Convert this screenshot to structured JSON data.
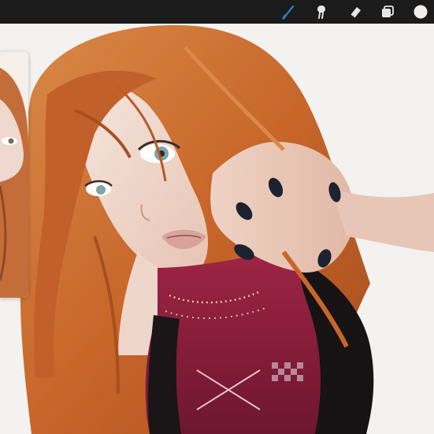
{
  "toolbar": {
    "tools": [
      {
        "name": "brush",
        "icon": "brush-icon",
        "active": true
      },
      {
        "name": "smudge",
        "icon": "smudge-icon",
        "active": false
      },
      {
        "name": "eraser",
        "icon": "eraser-icon",
        "active": false
      },
      {
        "name": "layers",
        "icon": "layers-icon",
        "active": false
      },
      {
        "name": "color",
        "icon": "color-swatch",
        "active": false
      }
    ],
    "active_color": "#3a7bd5",
    "swatch_color": "#f2efea"
  },
  "artwork": {
    "description_colors": {
      "hair": "#c8662a",
      "skin": "#f1ddd3",
      "nails": "#1c2230",
      "top": "#8a1f3a",
      "background": "#f3f2f0"
    }
  }
}
